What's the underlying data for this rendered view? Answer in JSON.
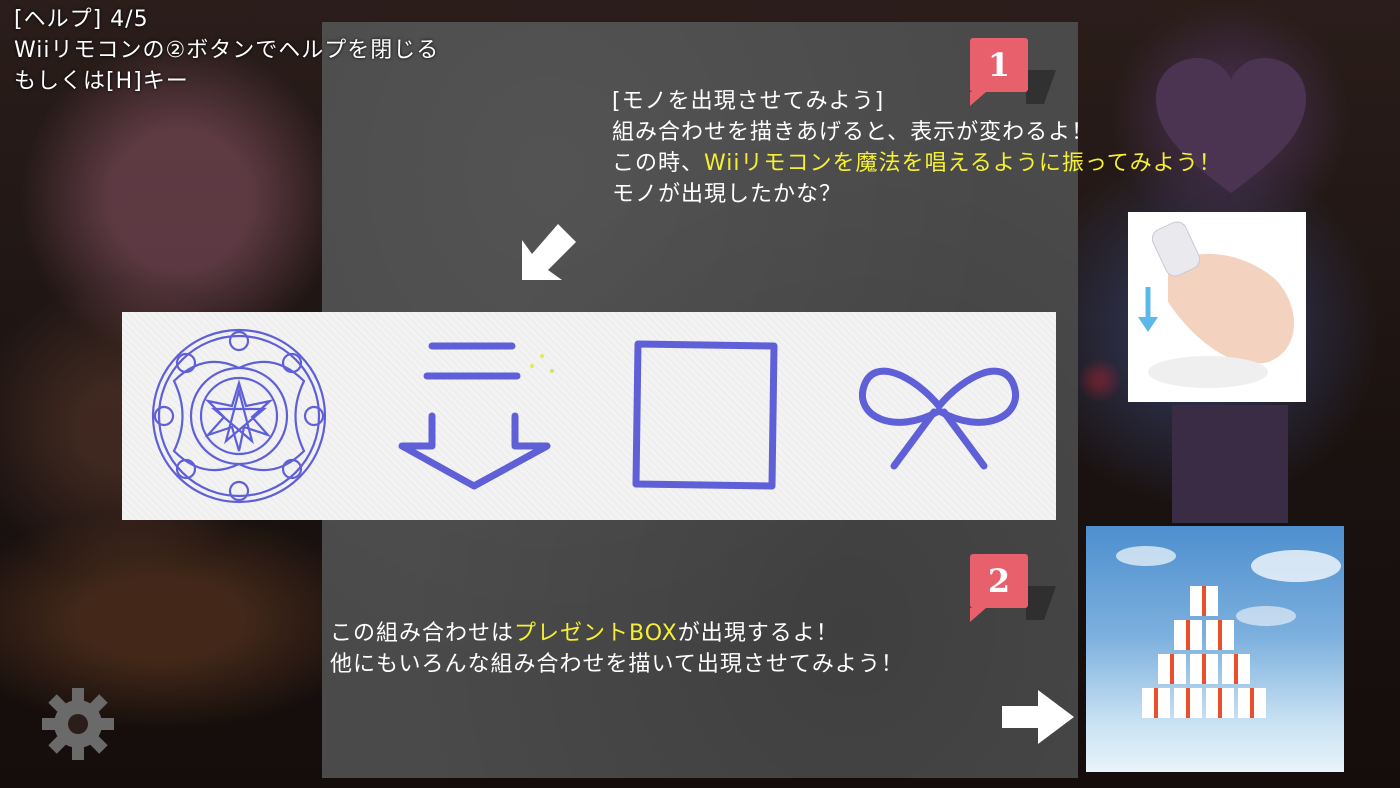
{
  "help": {
    "page_label": "[ヘルプ] 4/5",
    "close_hint_line1": "Wiiリモコンの②ボタンでヘルプを閉じる",
    "close_hint_line2": "もしくは[H]キー"
  },
  "step1": {
    "badge": "1",
    "title": "[モノを出現させてみよう]",
    "line1": "組み合わせを描きあげると、表示が変わるよ！",
    "line2_prefix": "この時、",
    "line2_highlight": "Wiiリモコンを魔法を唱えるように振ってみよう！",
    "line3": "モノが出現したかな？"
  },
  "step2": {
    "badge": "2",
    "line1_prefix": "この組み合わせは",
    "line1_highlight": "プレゼントBOX",
    "line1_suffix": "が出現するよ！",
    "line2": "他にもいろんな組み合わせを描いて出現させてみよう！"
  },
  "symbols": [
    "magic-circle",
    "down-arrow",
    "square",
    "ribbon-bow"
  ],
  "icons": {
    "settings": "gear-icon",
    "pointer_down_left": "arrow-down-left-icon",
    "pointer_right": "arrow-right-icon",
    "heart": "heart-icon"
  },
  "colors": {
    "badge": "#e8606c",
    "highlight": "#f5f033",
    "symbol_stroke": "#5f5fd8",
    "panel": "#4a4a4a"
  }
}
